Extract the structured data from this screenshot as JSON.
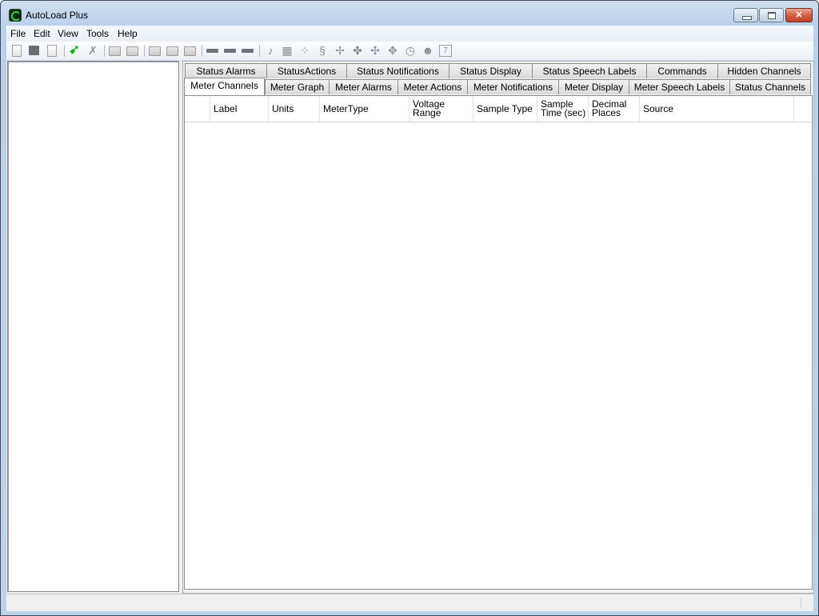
{
  "window": {
    "title": "AutoLoad Plus",
    "controls": {
      "minimize": "minimize",
      "maximize": "maximize",
      "close": "close"
    }
  },
  "menubar": {
    "items": [
      {
        "label": "File"
      },
      {
        "label": "Edit"
      },
      {
        "label": "View"
      },
      {
        "label": "Tools"
      },
      {
        "label": "Help"
      }
    ]
  },
  "toolbar": {
    "buttons": [
      {
        "icon": "new-document-icon"
      },
      {
        "icon": "save-icon"
      },
      {
        "icon": "save-copy-icon"
      },
      {
        "icon": "connect-icon"
      },
      {
        "icon": "disconnect-icon"
      },
      {
        "icon": "folder-icon"
      },
      {
        "icon": "open-folder-icon"
      },
      {
        "icon": "export-icon"
      },
      {
        "icon": "import-icon"
      },
      {
        "icon": "preview-icon"
      },
      {
        "icon": "add-meter-icon"
      },
      {
        "icon": "add-device-icon"
      },
      {
        "icon": "remove-device-icon"
      },
      {
        "icon": "alarm-bell-icon"
      },
      {
        "icon": "calendar-icon"
      },
      {
        "icon": "grid-icon"
      },
      {
        "icon": "script-icon"
      },
      {
        "icon": "network-settings-icon"
      },
      {
        "icon": "device-settings-icon"
      },
      {
        "icon": "network-config-icon"
      },
      {
        "icon": "link-settings-icon"
      },
      {
        "icon": "clock-icon"
      },
      {
        "icon": "users-icon"
      },
      {
        "icon": "date-icon"
      }
    ],
    "date_icon_text": "7"
  },
  "tabs": {
    "row_back": [
      {
        "label": "Status Alarms"
      },
      {
        "label": "StatusActions"
      },
      {
        "label": "Status Notifications"
      },
      {
        "label": "Status Display"
      },
      {
        "label": "Status Speech Labels"
      },
      {
        "label": "Commands"
      },
      {
        "label": "Hidden Channels"
      }
    ],
    "row_front": [
      {
        "label": "Meter Channels",
        "active": true
      },
      {
        "label": "Meter Graph"
      },
      {
        "label": "Meter Alarms"
      },
      {
        "label": "Meter Actions"
      },
      {
        "label": "Meter Notifications"
      },
      {
        "label": "Meter Display"
      },
      {
        "label": "Meter Speech Labels"
      },
      {
        "label": "Status Channels"
      }
    ]
  },
  "grid": {
    "columns": [
      {
        "label": ""
      },
      {
        "label": "Label"
      },
      {
        "label": "Units"
      },
      {
        "label": "MeterType"
      },
      {
        "label": "Voltage Range"
      },
      {
        "label": "Sample Type"
      },
      {
        "label": "Sample Time (sec)"
      },
      {
        "label": "Decimal Places"
      },
      {
        "label": "Source"
      }
    ],
    "rows": []
  },
  "statusbar": {
    "text": ""
  }
}
